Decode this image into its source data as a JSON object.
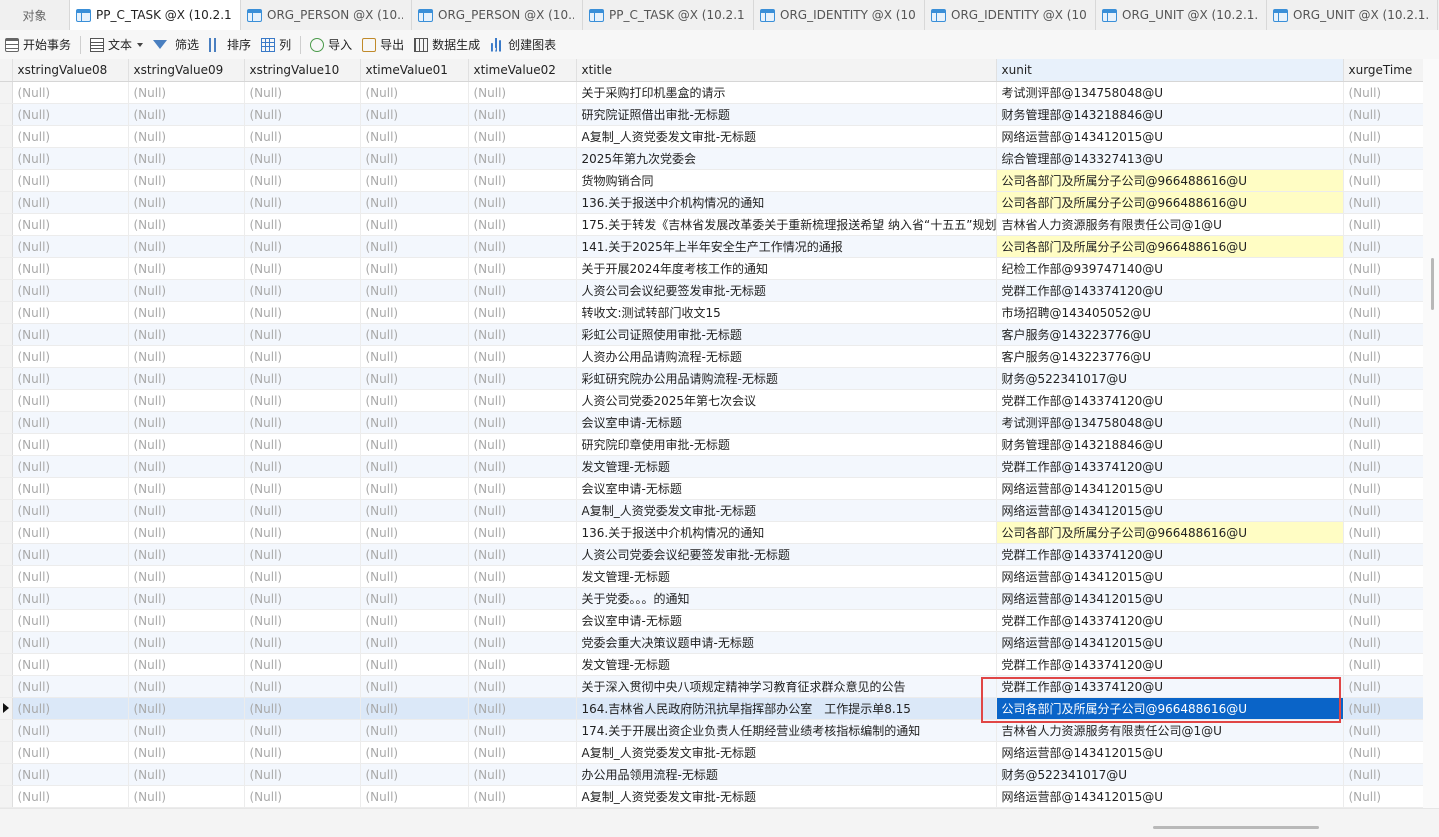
{
  "tabs": [
    {
      "label": "对象",
      "active": false
    },
    {
      "label": "PP_C_TASK @X (10.2.1...",
      "active": true
    },
    {
      "label": "ORG_PERSON @X (10....",
      "active": false
    },
    {
      "label": "ORG_PERSON @X (10....",
      "active": false
    },
    {
      "label": "PP_C_TASK @X (10.2.1...",
      "active": false
    },
    {
      "label": "ORG_IDENTITY @X (10...",
      "active": false
    },
    {
      "label": "ORG_IDENTITY @X (10...",
      "active": false
    },
    {
      "label": "ORG_UNIT @X (10.2.1...",
      "active": false
    },
    {
      "label": "ORG_UNIT @X (10.2.1...",
      "active": false
    }
  ],
  "toolbar": {
    "begin_transaction": "开始事务",
    "text": "文本",
    "filter": "筛选",
    "sort": "排序",
    "columns": "列",
    "import": "导入",
    "export": "导出",
    "generate_data": "数据生成",
    "create_chart": "创建图表"
  },
  "columns": [
    "xstringValue08",
    "xstringValue09",
    "xstringValue10",
    "xtimeValue01",
    "xtimeValue02",
    "xtitle",
    "xunit",
    "xurgeTime"
  ],
  "null_text": "(Null)",
  "rows": [
    {
      "xtitle": "关于采购打印机墨盒的请示",
      "xunit": "考试测评部@134758048@U",
      "hl": false
    },
    {
      "xtitle": "研究院证照借出审批-无标题",
      "xunit": "财务管理部@143218846@U",
      "hl": false
    },
    {
      "xtitle": "A复制_人资党委发文审批-无标题",
      "xunit": "网络运营部@143412015@U",
      "hl": false
    },
    {
      "xtitle": "2025年第九次党委会",
      "xunit": "综合管理部@143327413@U",
      "hl": false
    },
    {
      "xtitle": "货物购销合同",
      "xunit": "公司各部门及所属分子公司@966488616@U",
      "hl": true
    },
    {
      "xtitle": "136.关于报送中介机构情况的通知",
      "xunit": "公司各部门及所属分子公司@966488616@U",
      "hl": true
    },
    {
      "xtitle": "175.关于转发《吉林省发展改革委关于重新梳理报送希望 纳入省“十五五”规划",
      "xunit": "吉林省人力资源服务有限责任公司@1@U",
      "hl": false
    },
    {
      "xtitle": "141.关于2025年上半年安全生产工作情况的通报",
      "xunit": "公司各部门及所属分子公司@966488616@U",
      "hl": true
    },
    {
      "xtitle": "关于开展2024年度考核工作的通知",
      "xunit": "纪检工作部@939747140@U",
      "hl": false
    },
    {
      "xtitle": "人资公司会议纪要签发审批-无标题",
      "xunit": "党群工作部@143374120@U",
      "hl": false
    },
    {
      "xtitle": "转收文:测试转部门收文15",
      "xunit": "市场招聘@143405052@U",
      "hl": false
    },
    {
      "xtitle": "彩虹公司证照使用审批-无标题",
      "xunit": "客户服务@143223776@U",
      "hl": false
    },
    {
      "xtitle": "人资办公用品请购流程-无标题",
      "xunit": "客户服务@143223776@U",
      "hl": false
    },
    {
      "xtitle": "彩虹研究院办公用品请购流程-无标题",
      "xunit": "财务@522341017@U",
      "hl": false
    },
    {
      "xtitle": "人资公司党委2025年第七次会议",
      "xunit": "党群工作部@143374120@U",
      "hl": false
    },
    {
      "xtitle": "会议室申请-无标题",
      "xunit": "考试测评部@134758048@U",
      "hl": false
    },
    {
      "xtitle": "研究院印章使用审批-无标题",
      "xunit": "财务管理部@143218846@U",
      "hl": false
    },
    {
      "xtitle": "发文管理-无标题",
      "xunit": "党群工作部@143374120@U",
      "hl": false
    },
    {
      "xtitle": "会议室申请-无标题",
      "xunit": "网络运营部@143412015@U",
      "hl": false
    },
    {
      "xtitle": "A复制_人资党委发文审批-无标题",
      "xunit": "网络运营部@143412015@U",
      "hl": false
    },
    {
      "xtitle": "136.关于报送中介机构情况的通知",
      "xunit": "公司各部门及所属分子公司@966488616@U",
      "hl": true
    },
    {
      "xtitle": "人资公司党委会议纪要签发审批-无标题",
      "xunit": "党群工作部@143374120@U",
      "hl": false
    },
    {
      "xtitle": "发文管理-无标题",
      "xunit": "网络运营部@143412015@U",
      "hl": false
    },
    {
      "xtitle": "关于党委。。。的通知",
      "xunit": "网络运营部@143412015@U",
      "hl": false
    },
    {
      "xtitle": "会议室申请-无标题",
      "xunit": "党群工作部@143374120@U",
      "hl": false
    },
    {
      "xtitle": "党委会重大决策议题申请-无标题",
      "xunit": "网络运营部@143412015@U",
      "hl": false
    },
    {
      "xtitle": "发文管理-无标题",
      "xunit": "党群工作部@143374120@U",
      "hl": false
    },
    {
      "xtitle": "关于深入贯彻中央八项规定精神学习教育征求群众意见的公告",
      "xunit": "党群工作部@143374120@U",
      "hl": false
    },
    {
      "xtitle": "164.吉林省人民政府防汛抗旱指挥部办公室　工作提示单8.15",
      "xunit": "公司各部门及所属分子公司@966488616@U",
      "hl": false,
      "current": true
    },
    {
      "xtitle": "174.关于开展出资企业负责人任期经营业绩考核指标编制的通知",
      "xunit": "吉林省人力资源服务有限责任公司@1@U",
      "hl": false
    },
    {
      "xtitle": "A复制_人资党委发文审批-无标题",
      "xunit": "网络运营部@143412015@U",
      "hl": false
    },
    {
      "xtitle": "办公用品领用流程-无标题",
      "xunit": "财务@522341017@U",
      "hl": false
    },
    {
      "xtitle": "A复制_人资党委发文审批-无标题",
      "xunit": "网络运营部@143412015@U",
      "hl": false
    }
  ]
}
